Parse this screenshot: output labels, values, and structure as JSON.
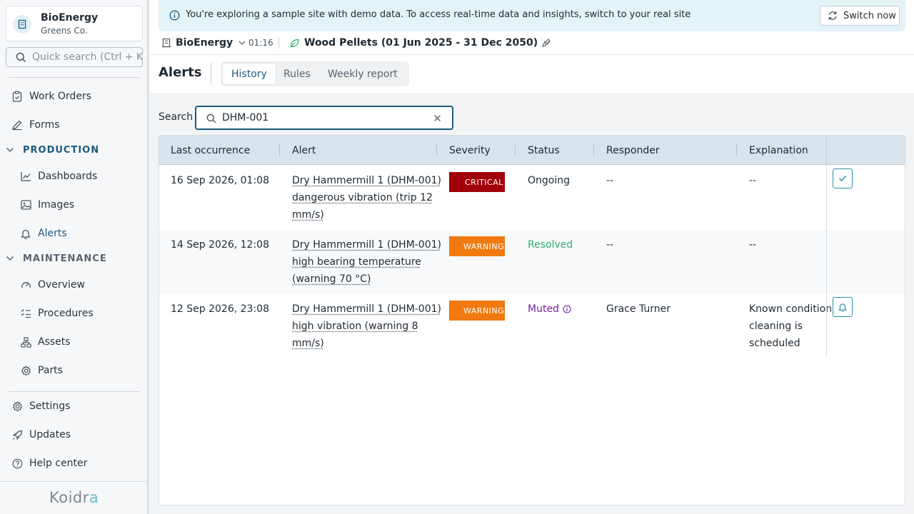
{
  "org": {
    "name": "BioEnergy",
    "company": "Greens Co."
  },
  "sidebar": {
    "search_placeholder": "Quick search (Ctrl + K)",
    "work_orders": "Work Orders",
    "forms": "Forms",
    "production_section": "PRODUCTION",
    "production_items": [
      "Dashboards",
      "Images",
      "Alerts"
    ],
    "maintenance_section": "MAINTENANCE",
    "maintenance_items": [
      "Overview",
      "Procedures",
      "Assets",
      "Parts"
    ],
    "settings": "Settings",
    "updates": "Updates",
    "help": "Help center",
    "logo": {
      "main": "Koidr",
      "accent": "a"
    }
  },
  "banner": {
    "text": "You're exploring a sample site with demo data. To access real-time data and insights, switch to your real site",
    "button": "Switch now"
  },
  "context": {
    "site": "BioEnergy",
    "time": "01:16",
    "product": "Wood Pellets (01 Jun 2025 - 31 Dec 2050)"
  },
  "page": {
    "title": "Alerts",
    "tabs": [
      "History",
      "Rules",
      "Weekly report"
    ],
    "active_tab": "History"
  },
  "search": {
    "label": "Search",
    "value": "DHM-001"
  },
  "table": {
    "columns": [
      "Last occurrence",
      "Alert",
      "Severity",
      "Status",
      "Responder",
      "Explanation"
    ],
    "rows": [
      {
        "time": "16 Sep 2026, 01:08",
        "alert": [
          "Dry Hammermill 1 (DHM-001)",
          "dangerous vibration (trip 12",
          "mm/s)"
        ],
        "severity": "CRITICAL",
        "status": "Ongoing",
        "responder": "--",
        "explanation": [
          "--"
        ],
        "action_icon": "check-icon"
      },
      {
        "time": "14 Sep 2026, 12:08",
        "alert": [
          "Dry Hammermill 1 (DHM-001)",
          "high bearing temperature",
          "(warning 70 °C)"
        ],
        "severity": "WARNING",
        "status": "Resolved",
        "responder": "--",
        "explanation": [
          "--"
        ],
        "action_icon": ""
      },
      {
        "time": "12 Sep 2026, 23:08",
        "alert": [
          "Dry Hammermill 1 (DHM-001)",
          "high vibration (warning 8",
          "mm/s)"
        ],
        "severity": "WARNING",
        "status": "Muted",
        "responder": "Grace Turner",
        "explanation": [
          "Known condition",
          "cleaning is",
          "scheduled"
        ],
        "action_icon": "bell-icon"
      }
    ]
  },
  "colors": {
    "accent": "#1c5a7e",
    "critical": "#a1000a",
    "warning": "#f07a10",
    "resolved": "#2fae73",
    "muted": "#7a1aa0"
  }
}
